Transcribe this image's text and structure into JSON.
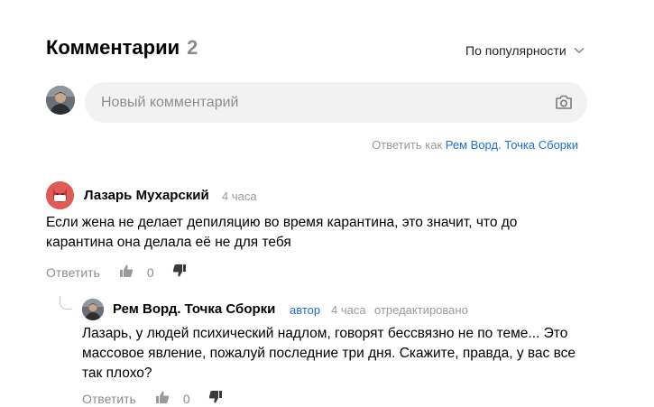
{
  "header": {
    "title": "Комментарии",
    "count": "2",
    "sort_label": "По популярности"
  },
  "composer": {
    "placeholder": "Новый комментарий",
    "reply_as_prefix": "Ответить как",
    "reply_as_name": "Рем Ворд. Точка Сборки"
  },
  "comments": [
    {
      "author": "Лазарь Мухарский",
      "time": "4 часа",
      "text": "Если жена не делает депиляцию во время карантина, это значит, что до карантина она делала её не для тебя",
      "reply_label": "Ответить",
      "score": "0",
      "avatar_icon": "cat-mask-icon",
      "avatar_color": "#e05a56"
    },
    {
      "author": "Рем Ворд. Точка Сборки",
      "role": "автор",
      "time": "4 часа",
      "edited": "отредактировано",
      "text": "Лазарь, у людей психический надлом, говорят бессвязно не по теме... Это массовое явление, пожалуй последние три дня. Скажите, правда, у вас все так плохо?",
      "reply_label": "Ответить",
      "score": "0"
    }
  ],
  "colors": {
    "link": "#1a6ed8",
    "muted": "#9a9a9a",
    "input_bg": "#f2f2f2"
  }
}
